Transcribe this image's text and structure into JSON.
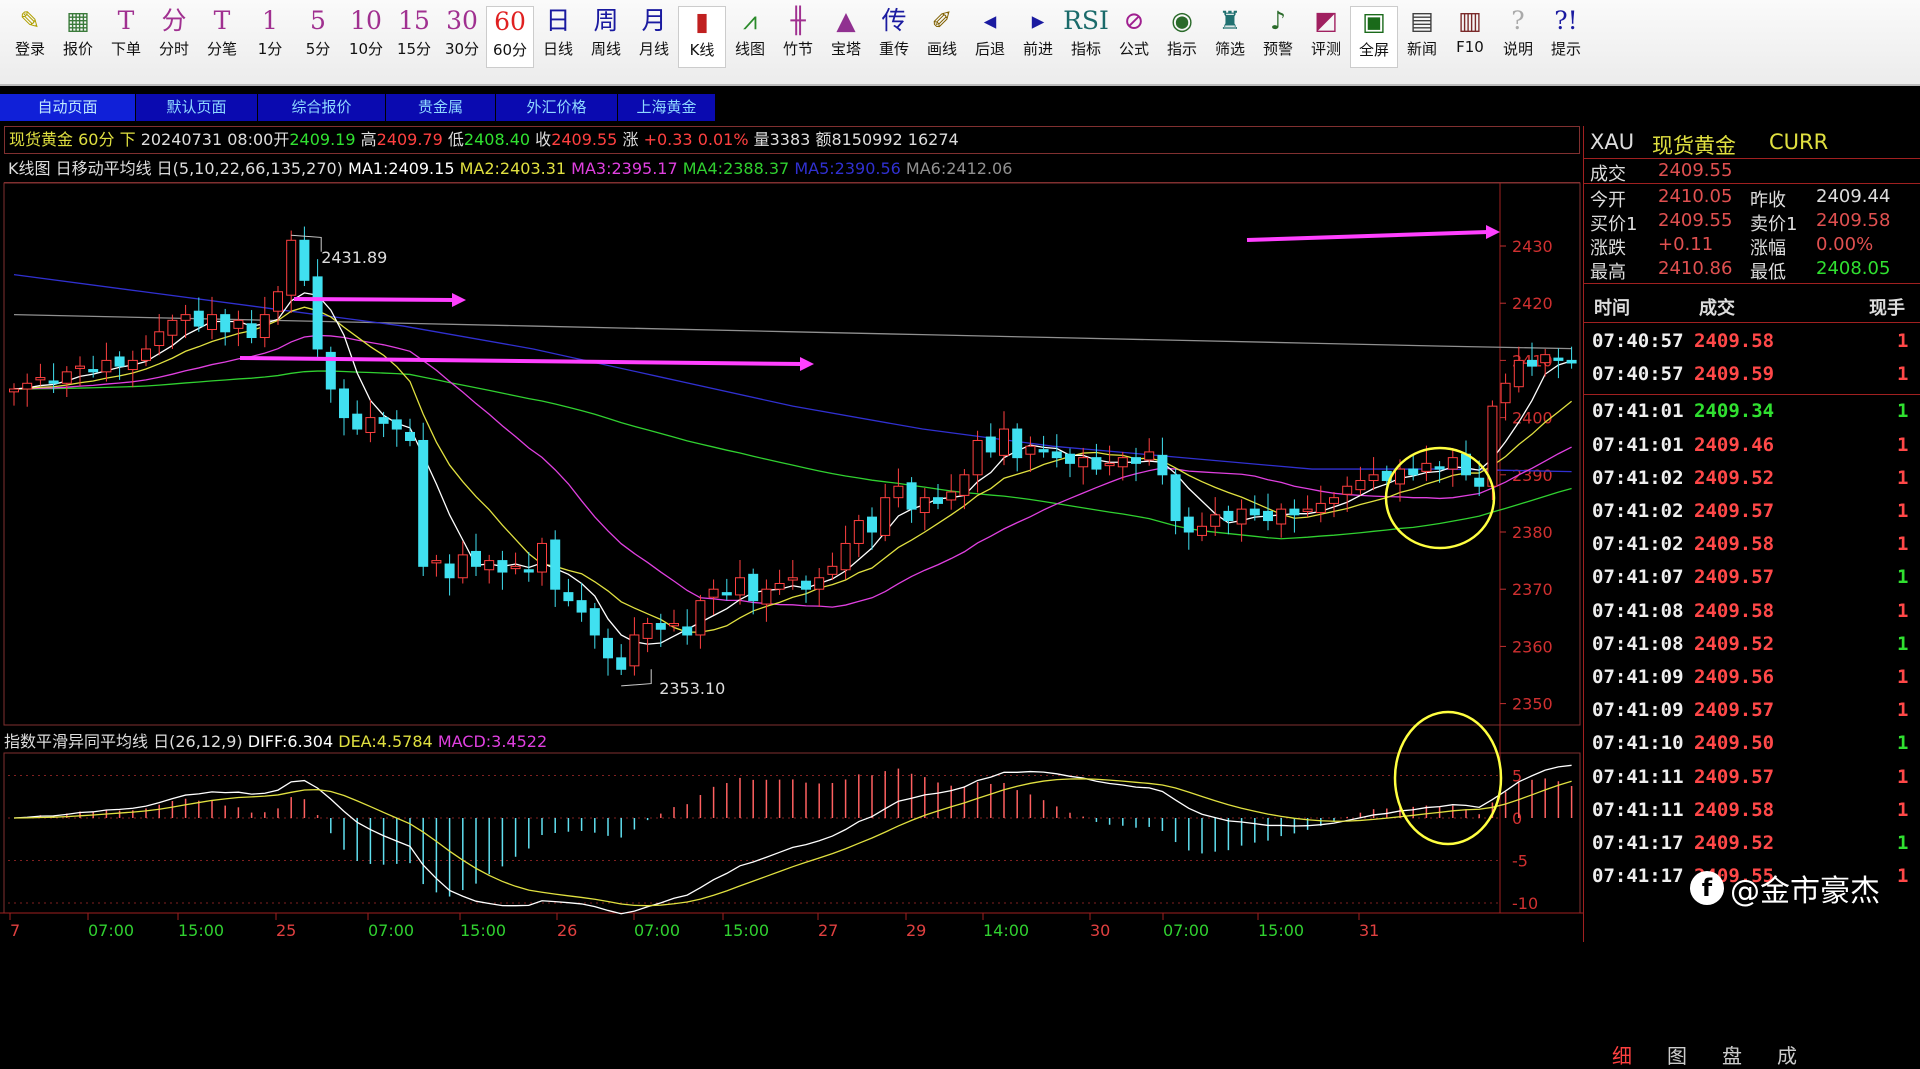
{
  "toolbar": [
    {
      "icon": "✎",
      "label": "登录",
      "color": "#b0a000"
    },
    {
      "icon": "▦",
      "label": "报价",
      "color": "#3a7a3a"
    },
    {
      "icon": "T",
      "label": "下单",
      "color": "#a03090"
    },
    {
      "icon": "分",
      "label": "分时",
      "color": "#a03090"
    },
    {
      "icon": "T",
      "label": "分笔",
      "color": "#a03090"
    },
    {
      "icon": "1",
      "label": "1分",
      "color": "#a03090"
    },
    {
      "icon": "5",
      "label": "5分",
      "color": "#a03090"
    },
    {
      "icon": "10",
      "label": "10分",
      "color": "#a03090"
    },
    {
      "icon": "15",
      "label": "15分",
      "color": "#a03090"
    },
    {
      "icon": "30",
      "label": "30分",
      "color": "#a03090"
    },
    {
      "icon": "60",
      "label": "60分",
      "color": "#e02020"
    },
    {
      "icon": "日",
      "label": "日线",
      "color": "#1a1aa0"
    },
    {
      "icon": "周",
      "label": "周线",
      "color": "#1a1aa0"
    },
    {
      "icon": "月",
      "label": "月线",
      "color": "#1a1aa0"
    },
    {
      "icon": "▮",
      "label": "K线",
      "color": "#c02020"
    },
    {
      "icon": "⩘",
      "label": "线图",
      "color": "#2a8a2a"
    },
    {
      "icon": "╫",
      "label": "竹节",
      "color": "#a03090"
    },
    {
      "icon": "▲",
      "label": "宝塔",
      "color": "#903090"
    },
    {
      "icon": "传",
      "label": "重传",
      "color": "#1a1aa0"
    },
    {
      "icon": "✐",
      "label": "画线",
      "color": "#806000"
    },
    {
      "icon": "◂",
      "label": "后退",
      "color": "#1a1aa0"
    },
    {
      "icon": "▸",
      "label": "前进",
      "color": "#1a1aa0"
    },
    {
      "icon": "RSI",
      "label": "指标",
      "color": "#1a6a6a"
    },
    {
      "icon": "⊘",
      "label": "公式",
      "color": "#a02090"
    },
    {
      "icon": "◉",
      "label": "指示",
      "color": "#2a6a2a"
    },
    {
      "icon": "♜",
      "label": "筛选",
      "color": "#207070"
    },
    {
      "icon": "♪",
      "label": "预警",
      "color": "#2a6a2a"
    },
    {
      "icon": "◩",
      "label": "评测",
      "color": "#a02060"
    },
    {
      "icon": "▣",
      "label": "全屏",
      "color": "#1a6a1a"
    },
    {
      "icon": "▤",
      "label": "新闻",
      "color": "#404040"
    },
    {
      "icon": "▥",
      "label": "F10",
      "color": "#7a2a2a"
    },
    {
      "icon": "?",
      "label": "说明",
      "color": "#aaaaaa"
    },
    {
      "icon": "?!",
      "label": "提示",
      "color": "#1a1aa0"
    }
  ],
  "tabs": [
    "自动页面",
    "默认页面",
    "综合报价",
    "贵金属",
    "外汇价格",
    "上海黄金"
  ],
  "info": {
    "name": "现货黄金",
    "period": "60分",
    "dir": "下",
    "datetime": "20240731 08:00",
    "open_label": "开",
    "open": "2409.19",
    "high_label": "高",
    "high": "2409.79",
    "low_label": "低",
    "low": "2408.40",
    "close_label": "收",
    "close": "2409.55",
    "chg_label": "涨",
    "chg": "+0.33",
    "pct": "0.01%",
    "vol": "量3383",
    "amt": "额8150992",
    "oi": "16274"
  },
  "ma": {
    "title": "K线图 日移动平均线 日(5,10,22,66,135,270)",
    "ma1": "MA1:2409.15",
    "ma2": "MA2:2403.31",
    "ma3": "MA3:2395.17",
    "ma4": "MA4:2388.37",
    "ma5": "MA5:2390.56",
    "ma6": "MA6:2412.06"
  },
  "macd": {
    "title": "指数平滑异同平均线 日(26,12,9)",
    "diff": "DIFF:6.304",
    "dea": "DEA:4.5784",
    "macd": "MACD:3.4522"
  },
  "colors": {
    "up": "#ff4040",
    "down": "#40e0f0",
    "ma1": "#ffffff",
    "ma2": "#e0e040",
    "ma3": "#e040e0",
    "ma4": "#30d030",
    "ma5": "#3030d0",
    "ma6": "#909090",
    "arrow": "#ff40ff",
    "circle": "#ffff40"
  },
  "chart_data": {
    "type": "candlestick",
    "ylim": [
      2345,
      2437
    ],
    "price_ticks": [
      "2430",
      "2420",
      "2410",
      "2400",
      "2390",
      "2380",
      "2370",
      "2360",
      "2350"
    ],
    "macd_ticks": [
      "5",
      "0",
      "-5",
      "-10"
    ],
    "annotations": {
      "high": "2431.89",
      "low": "2353.10"
    },
    "closes": [
      2405,
      2406,
      2407,
      2406,
      2408,
      2409,
      2408,
      2410,
      2409,
      2410,
      2412,
      2415,
      2417,
      2418,
      2416,
      2418,
      2415,
      2417,
      2414,
      2418,
      2422,
      2431,
      2424,
      2412,
      2405,
      2400,
      2398,
      2400,
      2399,
      2398,
      2396,
      2374,
      2375,
      2372,
      2376,
      2374,
      2375,
      2373,
      2374,
      2373,
      2378,
      2370,
      2368,
      2366,
      2362,
      2358,
      2356,
      2362,
      2364,
      2363,
      2364,
      2362,
      2368,
      2370,
      2369,
      2372,
      2368,
      2370,
      2371,
      2372,
      2370,
      2372,
      2374,
      2378,
      2382,
      2380,
      2386,
      2388,
      2384,
      2386,
      2385,
      2387,
      2390,
      2396,
      2394,
      2398,
      2393,
      2395,
      2394,
      2393,
      2392,
      2393,
      2391,
      2392,
      2393,
      2392,
      2394,
      2390,
      2382,
      2380,
      2381,
      2383,
      2382,
      2384,
      2383,
      2382,
      2384,
      2383,
      2384,
      2385,
      2386,
      2388,
      2389,
      2390,
      2389,
      2391,
      2390,
      2392,
      2391,
      2393,
      2390,
      2388,
      2402,
      2406,
      2410,
      2409,
      2411,
      2410,
      2409.55
    ],
    "ma5_points": [
      2425,
      2422,
      2419,
      2416,
      2412,
      2407,
      2402,
      2398,
      2395,
      2393,
      2391,
      2391,
      2390.56
    ],
    "ma6_points": [
      2418,
      2417.5,
      2417,
      2416.5,
      2416,
      2415.5,
      2415,
      2414.5,
      2414,
      2413.5,
      2413,
      2412.5,
      2412.06
    ],
    "time_labels": [
      "7",
      "07:00",
      "15:00",
      "25",
      "07:00",
      "15:00",
      "26",
      "07:00",
      "15:00",
      "27",
      "29",
      "14:00",
      "30",
      "07:00",
      "15:00",
      "31"
    ]
  },
  "quote": {
    "symbol": "XAU",
    "name": "现货黄金",
    "type": "CURR",
    "last_label": "成交",
    "last": "2409.55",
    "open_label": "今开",
    "open": "2410.05",
    "prev_label": "昨收",
    "prev": "2409.44",
    "bid_label": "买价1",
    "bid": "2409.55",
    "ask_label": "卖价1",
    "ask": "2409.58",
    "chg_label": "涨跌",
    "chg": "+0.11",
    "pct_label": "涨幅",
    "pct": "0.00%",
    "high_label": "最高",
    "high": "2410.86",
    "low_label": "最低",
    "low": "2408.05"
  },
  "ticks_header": {
    "time": "时间",
    "price": "成交",
    "vol": "现手"
  },
  "ticks": [
    {
      "t": "07:40:57",
      "p": "2409.58",
      "v": "1",
      "pc": "up",
      "vc": "up"
    },
    {
      "t": "07:40:57",
      "p": "2409.59",
      "v": "1",
      "pc": "up",
      "vc": "up"
    },
    {
      "t": "07:41:01",
      "p": "2409.34",
      "v": "1",
      "pc": "dn",
      "vc": "dn"
    },
    {
      "t": "07:41:01",
      "p": "2409.46",
      "v": "1",
      "pc": "up",
      "vc": "up"
    },
    {
      "t": "07:41:02",
      "p": "2409.52",
      "v": "1",
      "pc": "up",
      "vc": "up"
    },
    {
      "t": "07:41:02",
      "p": "2409.57",
      "v": "1",
      "pc": "up",
      "vc": "up"
    },
    {
      "t": "07:41:02",
      "p": "2409.58",
      "v": "1",
      "pc": "up",
      "vc": "up"
    },
    {
      "t": "07:41:07",
      "p": "2409.57",
      "v": "1",
      "pc": "up",
      "vc": "dn"
    },
    {
      "t": "07:41:08",
      "p": "2409.58",
      "v": "1",
      "pc": "up",
      "vc": "up"
    },
    {
      "t": "07:41:08",
      "p": "2409.52",
      "v": "1",
      "pc": "up",
      "vc": "dn"
    },
    {
      "t": "07:41:09",
      "p": "2409.56",
      "v": "1",
      "pc": "up",
      "vc": "up"
    },
    {
      "t": "07:41:09",
      "p": "2409.57",
      "v": "1",
      "pc": "up",
      "vc": "up"
    },
    {
      "t": "07:41:10",
      "p": "2409.50",
      "v": "1",
      "pc": "up",
      "vc": "dn"
    },
    {
      "t": "07:41:11",
      "p": "2409.57",
      "v": "1",
      "pc": "up",
      "vc": "up"
    },
    {
      "t": "07:41:11",
      "p": "2409.58",
      "v": "1",
      "pc": "up",
      "vc": "up"
    },
    {
      "t": "07:41:17",
      "p": "2409.52",
      "v": "1",
      "pc": "up",
      "vc": "dn"
    },
    {
      "t": "07:41:17",
      "p": "2409.55",
      "v": "1",
      "pc": "up",
      "vc": "up"
    }
  ],
  "bottom_tabs": [
    "细",
    "图",
    "盘",
    "成"
  ],
  "watermark": "@金市豪杰"
}
